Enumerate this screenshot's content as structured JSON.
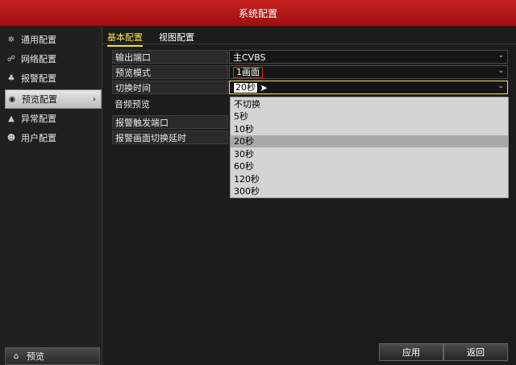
{
  "window": {
    "title": "系统配置"
  },
  "sidebar": {
    "items": [
      {
        "label": "通用配置",
        "icon": "gear-icon",
        "glyph": "✲"
      },
      {
        "label": "网络配置",
        "icon": "network-icon",
        "glyph": "☍"
      },
      {
        "label": "报警配置",
        "icon": "alarm-icon",
        "glyph": "♣"
      },
      {
        "label": "预览配置",
        "icon": "eye-icon",
        "glyph": "◉"
      },
      {
        "label": "异常配置",
        "icon": "warning-icon",
        "glyph": "▲"
      },
      {
        "label": "用户配置",
        "icon": "users-icon",
        "glyph": "☻"
      }
    ],
    "active_arrow": "›",
    "preview_button": {
      "label": "预览",
      "glyph": "⌂"
    }
  },
  "tabs": [
    {
      "label": "基本配置",
      "active": true
    },
    {
      "label": "视图配置",
      "active": false
    }
  ],
  "rows": {
    "output_port": {
      "label": "输出端口",
      "value": "主CVBS"
    },
    "preview_mode": {
      "label": "预览模式",
      "value": "1画面"
    },
    "switch_time": {
      "label": "切换时间",
      "value": "20秒"
    },
    "audio_preview": {
      "label": "音频预览"
    },
    "alarm_trigger_port": {
      "label": "报警触发端口"
    },
    "alarm_switch_delay": {
      "label": "报警画面切换延时"
    }
  },
  "dropdown": {
    "options": [
      "不切换",
      "5秒",
      "10秒",
      "20秒",
      "30秒",
      "60秒",
      "120秒",
      "300秒"
    ],
    "selected_index": 3
  },
  "chevron": "⌄",
  "buttons": {
    "apply": "应用",
    "back": "返回"
  },
  "colors": {
    "titlebar": "#b5181a",
    "tab_active": "#f2e34a",
    "dropdown_bg": "#d4d4d4",
    "selected_option": "#a9a9a9"
  }
}
